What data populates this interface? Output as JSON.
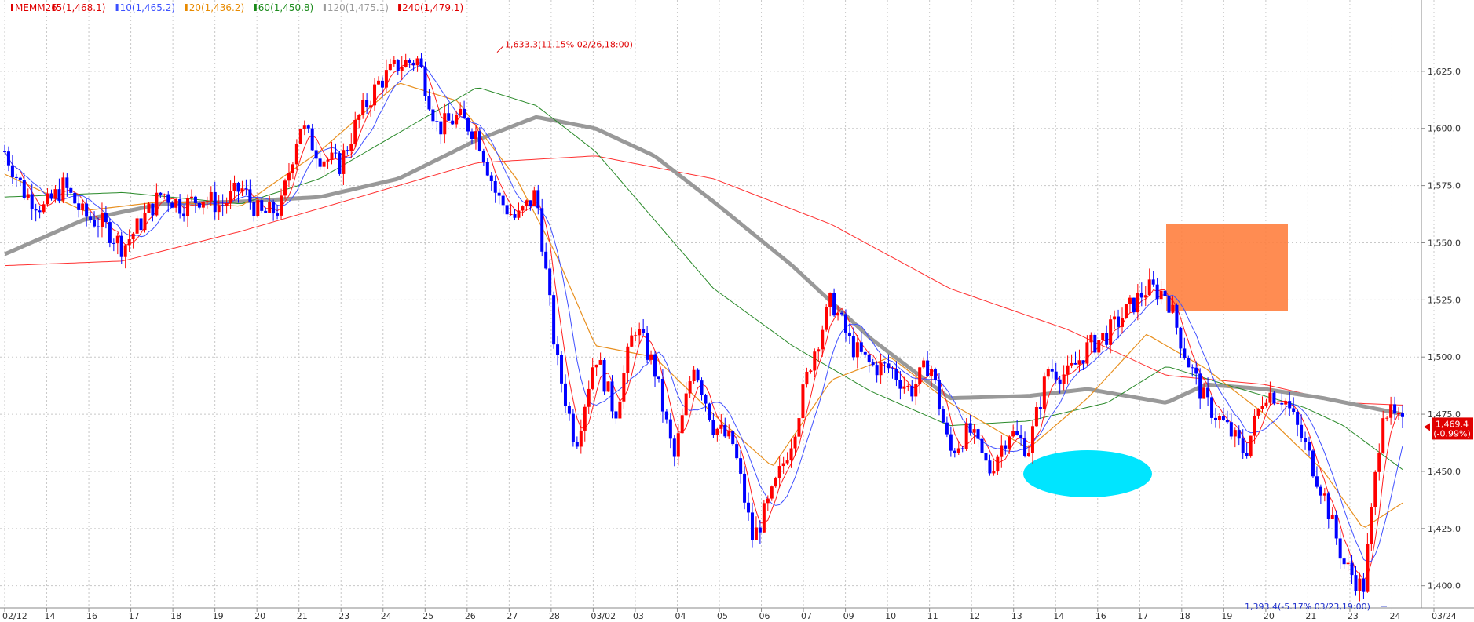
{
  "chart_data": {
    "type": "candlestick",
    "symbol": "MEMM26",
    "legend": [
      {
        "label": "MEMM26",
        "color": "#e00000",
        "period": null,
        "value": null
      },
      {
        "label": "5(1,468.1)",
        "color": "#e00000",
        "period": 5,
        "value": 1468.1
      },
      {
        "label": "10(1,465.2)",
        "color": "#3b50ff",
        "period": 10,
        "value": 1465.2
      },
      {
        "label": "20(1,436.2)",
        "color": "#e88a00",
        "period": 20,
        "value": 1436.2
      },
      {
        "label": "60(1,450.8)",
        "color": "#1a8a1a",
        "period": 60,
        "value": 1450.8
      },
      {
        "label": "120(1,475.1)",
        "color": "#9a9a9a",
        "period": 120,
        "value": 1475.1
      },
      {
        "label": "240(1,479.1)",
        "color": "#e00000",
        "period": 240,
        "value": 1479.1
      }
    ],
    "y_ticks": [
      1400.0,
      1425.0,
      1450.0,
      1475.0,
      1500.0,
      1525.0,
      1550.0,
      1575.0,
      1600.0,
      1625.0
    ],
    "y_tick_labels": [
      "1,400.0",
      "1,425.0",
      "1,450.0",
      "1,475.0",
      "1,500.0",
      "1,525.0",
      "1,550.0",
      "1,575.0",
      "1,600.0",
      "1,625.0"
    ],
    "ylim": [
      1392,
      1650
    ],
    "x_labels": [
      "02/12",
      "14",
      "16",
      "17",
      "18",
      "19",
      "20",
      "21",
      "23",
      "24",
      "25",
      "26",
      "27",
      "28",
      "03/02",
      "03",
      "04",
      "05",
      "06",
      "07",
      "09",
      "10",
      "11",
      "12",
      "13",
      "14",
      "16",
      "17",
      "18",
      "19",
      "20",
      "21",
      "23",
      "24",
      "03/24"
    ],
    "price_path": [
      {
        "x": 0,
        "y": 1590
      },
      {
        "x": 1,
        "y": 1572
      },
      {
        "x": 2,
        "y": 1565
      },
      {
        "x": 3,
        "y": 1575
      },
      {
        "x": 4,
        "y": 1562
      },
      {
        "x": 5,
        "y": 1558
      },
      {
        "x": 6,
        "y": 1548
      },
      {
        "x": 7,
        "y": 1560
      },
      {
        "x": 8,
        "y": 1572
      },
      {
        "x": 9,
        "y": 1566
      },
      {
        "x": 10,
        "y": 1570
      },
      {
        "x": 11,
        "y": 1566
      },
      {
        "x": 12,
        "y": 1574
      },
      {
        "x": 13,
        "y": 1562
      },
      {
        "x": 14,
        "y": 1565
      },
      {
        "x": 15,
        "y": 1602
      },
      {
        "x": 16,
        "y": 1588
      },
      {
        "x": 17,
        "y": 1584
      },
      {
        "x": 18,
        "y": 1605
      },
      {
        "x": 19,
        "y": 1620
      },
      {
        "x": 20,
        "y": 1628
      },
      {
        "x": 21,
        "y": 1630
      },
      {
        "x": 22,
        "y": 1600
      },
      {
        "x": 23,
        "y": 1605
      },
      {
        "x": 24,
        "y": 1598
      },
      {
        "x": 25,
        "y": 1570
      },
      {
        "x": 26,
        "y": 1560
      },
      {
        "x": 27,
        "y": 1572
      },
      {
        "x": 28,
        "y": 1500
      },
      {
        "x": 29,
        "y": 1462
      },
      {
        "x": 30,
        "y": 1502
      },
      {
        "x": 31,
        "y": 1475
      },
      {
        "x": 32,
        "y": 1514
      },
      {
        "x": 33,
        "y": 1495
      },
      {
        "x": 34,
        "y": 1455
      },
      {
        "x": 35,
        "y": 1498
      },
      {
        "x": 36,
        "y": 1470
      },
      {
        "x": 37,
        "y": 1462
      },
      {
        "x": 38,
        "y": 1420
      },
      {
        "x": 39,
        "y": 1440
      },
      {
        "x": 40,
        "y": 1465
      },
      {
        "x": 41,
        "y": 1500
      },
      {
        "x": 42,
        "y": 1525
      },
      {
        "x": 43,
        "y": 1505
      },
      {
        "x": 44,
        "y": 1496
      },
      {
        "x": 45,
        "y": 1495
      },
      {
        "x": 46,
        "y": 1485
      },
      {
        "x": 47,
        "y": 1498
      },
      {
        "x": 48,
        "y": 1458
      },
      {
        "x": 49,
        "y": 1468
      },
      {
        "x": 50,
        "y": 1450
      },
      {
        "x": 51,
        "y": 1468
      },
      {
        "x": 52,
        "y": 1460
      },
      {
        "x": 53,
        "y": 1495
      },
      {
        "x": 54,
        "y": 1492
      },
      {
        "x": 55,
        "y": 1504
      },
      {
        "x": 56,
        "y": 1510
      },
      {
        "x": 57,
        "y": 1520
      },
      {
        "x": 58,
        "y": 1530
      },
      {
        "x": 59,
        "y": 1528
      },
      {
        "x": 60,
        "y": 1500
      },
      {
        "x": 61,
        "y": 1480
      },
      {
        "x": 62,
        "y": 1470
      },
      {
        "x": 63,
        "y": 1458
      },
      {
        "x": 64,
        "y": 1485
      },
      {
        "x": 65,
        "y": 1482
      },
      {
        "x": 66,
        "y": 1462
      },
      {
        "x": 67,
        "y": 1440
      },
      {
        "x": 68,
        "y": 1410
      },
      {
        "x": 69,
        "y": 1398
      },
      {
        "x": 70,
        "y": 1478
      },
      {
        "x": 71,
        "y": 1469.4
      }
    ],
    "ma_paths": {
      "ma120": [
        {
          "x": 0,
          "y": 1545
        },
        {
          "x": 4,
          "y": 1560
        },
        {
          "x": 8,
          "y": 1567
        },
        {
          "x": 12,
          "y": 1568
        },
        {
          "x": 16,
          "y": 1570
        },
        {
          "x": 20,
          "y": 1578
        },
        {
          "x": 24,
          "y": 1595
        },
        {
          "x": 27,
          "y": 1605
        },
        {
          "x": 30,
          "y": 1600
        },
        {
          "x": 33,
          "y": 1588
        },
        {
          "x": 36,
          "y": 1568
        },
        {
          "x": 40,
          "y": 1540
        },
        {
          "x": 44,
          "y": 1508
        },
        {
          "x": 48,
          "y": 1482
        },
        {
          "x": 52,
          "y": 1483
        },
        {
          "x": 55,
          "y": 1486
        },
        {
          "x": 57,
          "y": 1483
        },
        {
          "x": 59,
          "y": 1480
        },
        {
          "x": 61,
          "y": 1488
        },
        {
          "x": 64,
          "y": 1486
        },
        {
          "x": 67,
          "y": 1482
        },
        {
          "x": 71,
          "y": 1475
        }
      ],
      "ma240": [
        {
          "x": 0,
          "y": 1540
        },
        {
          "x": 6,
          "y": 1542
        },
        {
          "x": 12,
          "y": 1555
        },
        {
          "x": 18,
          "y": 1570
        },
        {
          "x": 24,
          "y": 1585
        },
        {
          "x": 30,
          "y": 1588
        },
        {
          "x": 36,
          "y": 1578
        },
        {
          "x": 42,
          "y": 1558
        },
        {
          "x": 48,
          "y": 1530
        },
        {
          "x": 54,
          "y": 1512
        },
        {
          "x": 59,
          "y": 1492
        },
        {
          "x": 64,
          "y": 1488
        },
        {
          "x": 68,
          "y": 1480
        },
        {
          "x": 71,
          "y": 1479
        }
      ],
      "ma60": [
        {
          "x": 0,
          "y": 1570
        },
        {
          "x": 6,
          "y": 1572
        },
        {
          "x": 12,
          "y": 1567
        },
        {
          "x": 16,
          "y": 1578
        },
        {
          "x": 20,
          "y": 1598
        },
        {
          "x": 24,
          "y": 1618
        },
        {
          "x": 27,
          "y": 1610
        },
        {
          "x": 30,
          "y": 1590
        },
        {
          "x": 33,
          "y": 1560
        },
        {
          "x": 36,
          "y": 1530
        },
        {
          "x": 40,
          "y": 1505
        },
        {
          "x": 44,
          "y": 1485
        },
        {
          "x": 48,
          "y": 1470
        },
        {
          "x": 52,
          "y": 1472
        },
        {
          "x": 56,
          "y": 1480
        },
        {
          "x": 59,
          "y": 1496
        },
        {
          "x": 62,
          "y": 1488
        },
        {
          "x": 66,
          "y": 1478
        },
        {
          "x": 68,
          "y": 1470
        },
        {
          "x": 71,
          "y": 1450.8
        }
      ],
      "ma20": [
        {
          "x": 0,
          "y": 1580
        },
        {
          "x": 4,
          "y": 1564
        },
        {
          "x": 8,
          "y": 1568
        },
        {
          "x": 12,
          "y": 1566
        },
        {
          "x": 16,
          "y": 1590
        },
        {
          "x": 20,
          "y": 1620
        },
        {
          "x": 23,
          "y": 1612
        },
        {
          "x": 26,
          "y": 1578
        },
        {
          "x": 28,
          "y": 1545
        },
        {
          "x": 30,
          "y": 1505
        },
        {
          "x": 33,
          "y": 1500
        },
        {
          "x": 36,
          "y": 1475
        },
        {
          "x": 39,
          "y": 1452
        },
        {
          "x": 42,
          "y": 1490
        },
        {
          "x": 45,
          "y": 1500
        },
        {
          "x": 48,
          "y": 1480
        },
        {
          "x": 52,
          "y": 1460
        },
        {
          "x": 55,
          "y": 1482
        },
        {
          "x": 58,
          "y": 1510
        },
        {
          "x": 61,
          "y": 1495
        },
        {
          "x": 64,
          "y": 1475
        },
        {
          "x": 67,
          "y": 1450
        },
        {
          "x": 69,
          "y": 1425
        },
        {
          "x": 71,
          "y": 1436.2
        }
      ]
    },
    "annotations": {
      "high_label": "1,633.3(11.15% 02/26,18:00)",
      "low_label": "1,393.4(-5.17% 03/23,19:00)",
      "current_price": "1,469.4",
      "current_change": "(-0.99%)"
    },
    "colors": {
      "up": "#ff0000",
      "down": "#0000ff",
      "grid": "#c8c8c8",
      "highlight_rect": "#ff7f3f",
      "highlight_ellipse": "#00e5ff"
    }
  }
}
